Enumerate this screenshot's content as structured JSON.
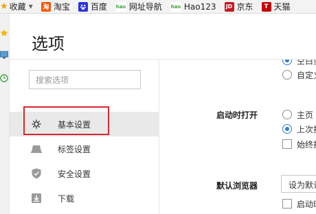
{
  "bookmarks_bar": {
    "items": [
      {
        "label": "收藏",
        "icon": "star-icon"
      },
      {
        "label": "淘宝",
        "icon": "taobao-icon",
        "color": "#ff5000",
        "glyph": "淘"
      },
      {
        "label": "百度",
        "icon": "baidu-paw-icon",
        "color": "#2932e1",
        "glyph": "🐾"
      },
      {
        "label": "网址导航",
        "icon": "hao-icon",
        "color": "#3aa33a",
        "glyph": "hao"
      },
      {
        "label": "Hao123",
        "icon": "hao123-icon",
        "color": "#3aa33a",
        "glyph": "hao"
      },
      {
        "label": "京东",
        "icon": "jd-icon",
        "color": "#c91623",
        "glyph": "JD"
      },
      {
        "label": "天猫",
        "icon": "tmall-icon",
        "color": "#c40000",
        "glyph": "T"
      }
    ]
  },
  "page": {
    "title": "选项"
  },
  "sidebar": {
    "search_placeholder": "搜索选项",
    "items": [
      {
        "label": "基本设置",
        "icon": "gear-icon",
        "active": true
      },
      {
        "label": "标签设置",
        "icon": "tab-icon",
        "active": false
      },
      {
        "label": "安全设置",
        "icon": "shield-icon",
        "active": false
      },
      {
        "label": "下载",
        "icon": "download-icon",
        "active": false
      }
    ]
  },
  "main": {
    "homepage_options": [
      {
        "label": "空白页",
        "checked": true
      },
      {
        "label": "自定义",
        "checked": false
      }
    ],
    "startup": {
      "label": "启动时打开",
      "options": [
        {
          "label": "主页",
          "checked": false
        },
        {
          "label": "上次打开",
          "checked": true
        }
      ],
      "checkbox_label": "始终打开"
    },
    "default_browser": {
      "label": "默认浏览器",
      "button_label": "设为默认",
      "checkbox_label": "启动时检查"
    }
  },
  "colors": {
    "accent": "#2f7ed8",
    "highlight": "#d9262b",
    "active_bg": "#e9e9e9"
  }
}
